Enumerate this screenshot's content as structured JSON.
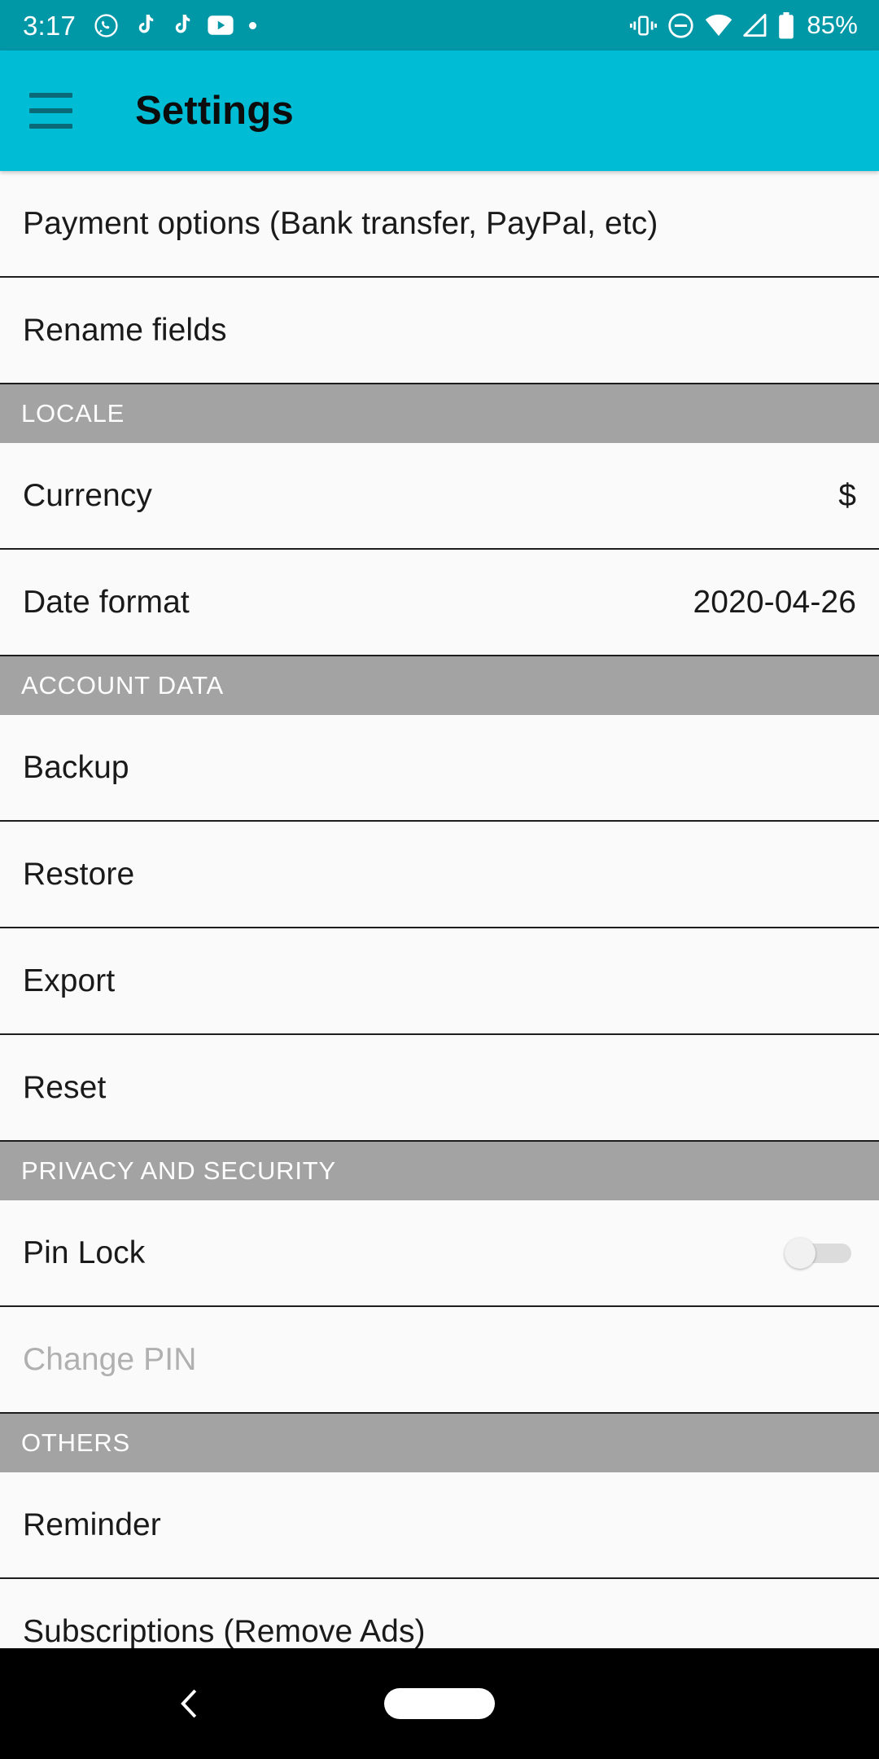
{
  "status_bar": {
    "time": "3:17",
    "battery_percent": "85%",
    "left_icons": [
      "whatsapp-icon",
      "tiktok-icon",
      "tiktok-icon",
      "youtube-icon",
      "notification-dot-icon"
    ],
    "right_icons": [
      "vibrate-icon",
      "do-not-disturb-icon",
      "wifi-icon",
      "cellular-signal-icon",
      "battery-icon"
    ],
    "background_color": "#0097A7",
    "foreground_color": "#FFFFFF"
  },
  "app_bar": {
    "title": "Settings",
    "menu_icon": "hamburger-menu-icon",
    "background_color": "#00BCD4",
    "title_color": "#0C0C0C"
  },
  "settings": {
    "rows": [
      {
        "type": "item",
        "label": "Payment options (Bank transfer, PayPal, etc)",
        "value": "",
        "enabled": true,
        "control": "none"
      },
      {
        "type": "item",
        "label": "Rename fields",
        "value": "",
        "enabled": true,
        "control": "none"
      },
      {
        "type": "header",
        "label": "LOCALE"
      },
      {
        "type": "item",
        "label": "Currency",
        "value": "$",
        "enabled": true,
        "control": "none"
      },
      {
        "type": "item",
        "label": "Date format",
        "value": "2020-04-26",
        "enabled": true,
        "control": "none"
      },
      {
        "type": "header",
        "label": "ACCOUNT DATA"
      },
      {
        "type": "item",
        "label": "Backup",
        "value": "",
        "enabled": true,
        "control": "none"
      },
      {
        "type": "item",
        "label": "Restore",
        "value": "",
        "enabled": true,
        "control": "none"
      },
      {
        "type": "item",
        "label": "Export",
        "value": "",
        "enabled": true,
        "control": "none"
      },
      {
        "type": "item",
        "label": "Reset",
        "value": "",
        "enabled": true,
        "control": "none"
      },
      {
        "type": "header",
        "label": "PRIVACY AND SECURITY"
      },
      {
        "type": "item",
        "label": "Pin Lock",
        "value": "",
        "enabled": true,
        "control": "switch",
        "switch_on": false
      },
      {
        "type": "item",
        "label": "Change PIN",
        "value": "",
        "enabled": false,
        "control": "none"
      },
      {
        "type": "header",
        "label": "OTHERS"
      },
      {
        "type": "item",
        "label": "Reminder",
        "value": "",
        "enabled": true,
        "control": "none"
      },
      {
        "type": "item",
        "label": "Subscriptions (Remove Ads)",
        "value": "",
        "enabled": true,
        "control": "none"
      }
    ],
    "section_header_color": "#A3A3A3",
    "row_background_color": "#FAFAFA",
    "divider_color": "#1D1D1D",
    "disabled_text_color": "#B0B0B0"
  },
  "nav_bar": {
    "back_icon": "chevron-back-icon",
    "home_icon": "home-pill-icon",
    "background_color": "#000000"
  }
}
